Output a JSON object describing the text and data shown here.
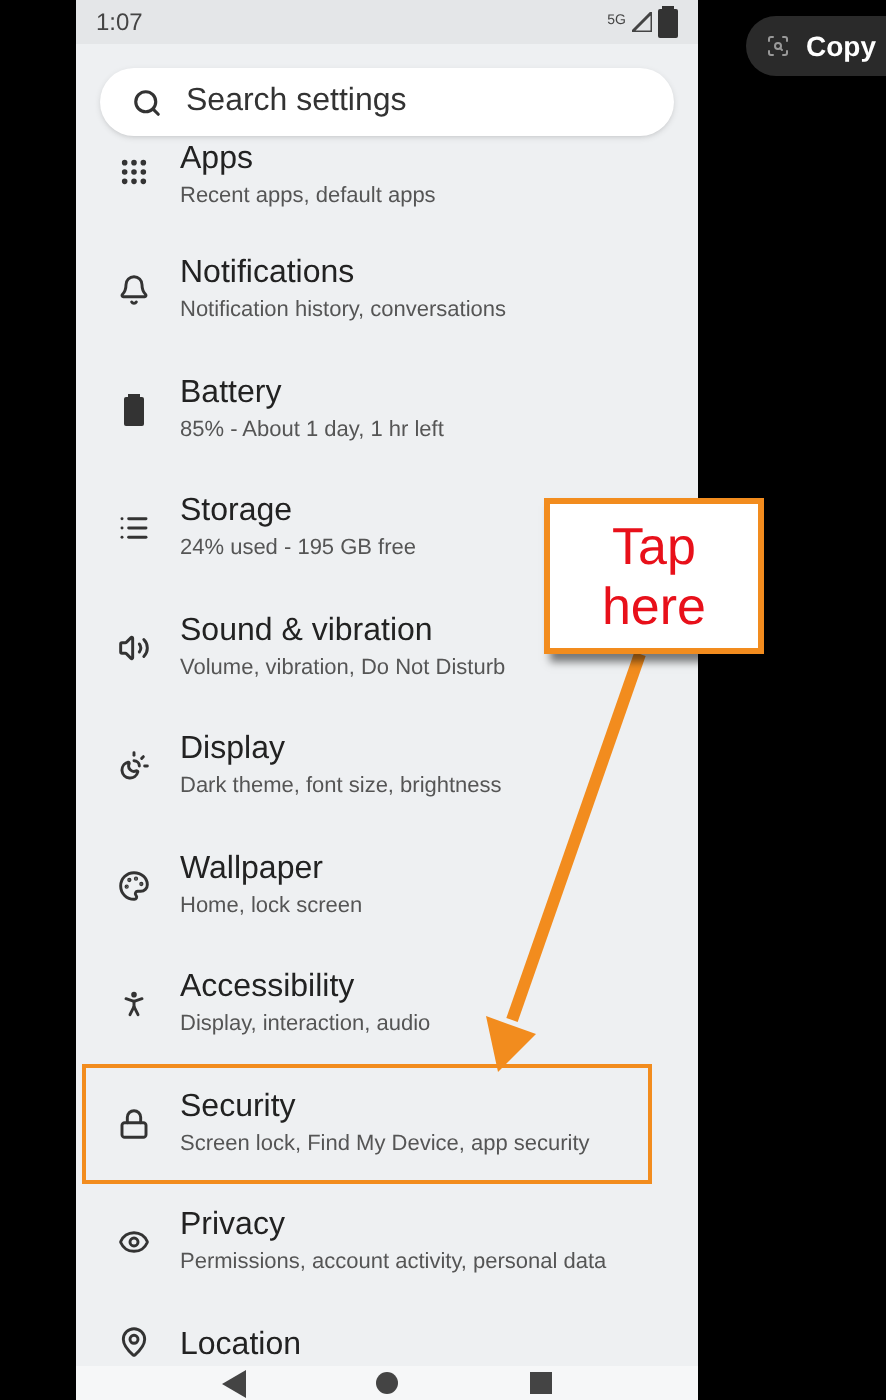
{
  "status_bar": {
    "time": "1:07",
    "network": "5G"
  },
  "copy_chip": {
    "label": "Copy"
  },
  "search": {
    "placeholder": "Search settings"
  },
  "items": [
    {
      "title": "Apps",
      "subtitle": "Recent apps, default apps",
      "highlighted": false
    },
    {
      "title": "Notifications",
      "subtitle": "Notification history, conversations",
      "highlighted": false
    },
    {
      "title": "Battery",
      "subtitle": "85% - About 1 day, 1 hr left",
      "highlighted": false
    },
    {
      "title": "Storage",
      "subtitle": "24% used - 195 GB free",
      "highlighted": false
    },
    {
      "title": "Sound & vibration",
      "subtitle": "Volume, vibration, Do Not Disturb",
      "highlighted": false
    },
    {
      "title": "Display",
      "subtitle": "Dark theme, font size, brightness",
      "highlighted": false
    },
    {
      "title": "Wallpaper",
      "subtitle": "Home, lock screen",
      "highlighted": false
    },
    {
      "title": "Accessibility",
      "subtitle": "Display, interaction, audio",
      "highlighted": false
    },
    {
      "title": "Security",
      "subtitle": "Screen lock, Find My Device, app security",
      "highlighted": true
    },
    {
      "title": "Privacy",
      "subtitle": "Permissions, account activity, personal data",
      "highlighted": false
    },
    {
      "title": "Location",
      "highlighted": false
    }
  ],
  "callout": {
    "text": "Tap here"
  }
}
